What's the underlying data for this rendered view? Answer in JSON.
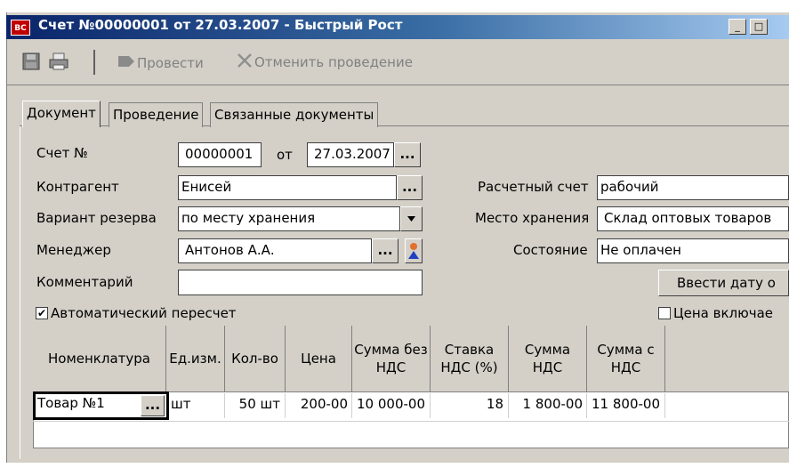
{
  "window": {
    "title": "Счет №00000001 от 27.03.2007 - Быстрый Рост",
    "icon_text": "BC",
    "minimize_glyph": "_",
    "maximize_glyph": "□"
  },
  "toolbar": {
    "save_icon": "save-icon",
    "print_icon": "print-icon",
    "post_label": "Провести",
    "cancel_post_label": "Отменить проведение"
  },
  "tabs": [
    {
      "label": "Документ",
      "active": true
    },
    {
      "label": "Проведение",
      "active": false
    },
    {
      "label": "Связанные документы",
      "active": false
    }
  ],
  "form": {
    "invoice_no_label": "Счет №",
    "invoice_no": "00000001",
    "date_label": "от",
    "date": "27.03.2007",
    "counterparty_label": "Контрагент",
    "counterparty": "Енисей",
    "reserve_label": "Вариант резерва",
    "reserve": "по месту хранения",
    "manager_label": "Менеджер",
    "manager": "Антонов А.А.",
    "comment_label": "Комментарий",
    "comment": "",
    "account_label": "Расчетный счет",
    "account": "рабочий",
    "storage_label": "Место хранения",
    "storage": "Склад оптовых товаров",
    "state_label": "Состояние",
    "state": "Не оплачен",
    "enter_date_button": "Ввести дату о",
    "auto_recalc_label": "Автоматический пересчет",
    "auto_recalc_checked": true,
    "price_incl_label": "Цена включае",
    "price_incl_checked": false,
    "ellipsis": "..."
  },
  "grid": {
    "headers": [
      "Номенклатура",
      "Ед.изм.",
      "Кол-во",
      "Цена",
      "Сумма без НДС",
      "Ставка НДС (%)",
      "Сумма НДС",
      "Сумма с НДС"
    ],
    "rows": [
      [
        "Товар №1",
        "шт",
        "50 шт",
        "200-00",
        "10 000-00",
        "18",
        "1 800-00",
        "11 800-00"
      ]
    ]
  }
}
